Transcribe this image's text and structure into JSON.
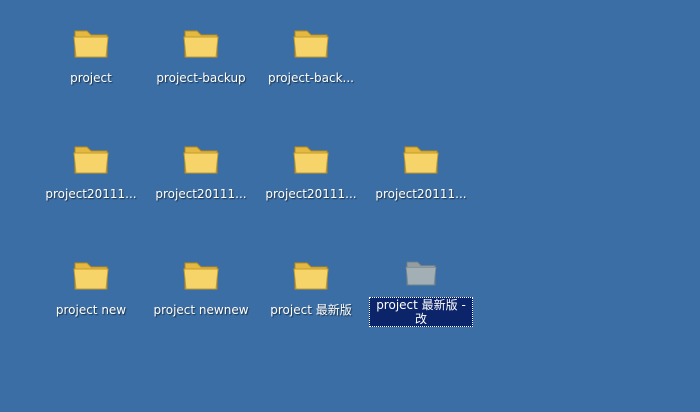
{
  "desktop": {
    "background_color": "#3a6ea5",
    "icons": [
      {
        "name": "project",
        "icon": "folder-icon",
        "selected": false
      },
      {
        "name": "project-backup",
        "icon": "folder-icon",
        "selected": false
      },
      {
        "name": "project-back...",
        "icon": "folder-icon",
        "selected": false
      },
      {
        "name": "project20111...",
        "icon": "folder-icon",
        "selected": false
      },
      {
        "name": "project20111...",
        "icon": "folder-icon",
        "selected": false
      },
      {
        "name": "project20111...",
        "icon": "folder-icon",
        "selected": false
      },
      {
        "name": "project20111...",
        "icon": "folder-icon",
        "selected": false
      },
      {
        "name": "project new",
        "icon": "folder-icon",
        "selected": false
      },
      {
        "name": "project newnew",
        "icon": "folder-icon",
        "selected": false
      },
      {
        "name": "project 最新版",
        "icon": "folder-icon",
        "selected": false
      },
      {
        "name": "project 最新版 - 改",
        "icon": "folder-icon",
        "selected": true
      }
    ]
  },
  "colors": {
    "folder_fill": "#f6d46a",
    "folder_back": "#e5b93f",
    "selection": "#0b246a"
  }
}
